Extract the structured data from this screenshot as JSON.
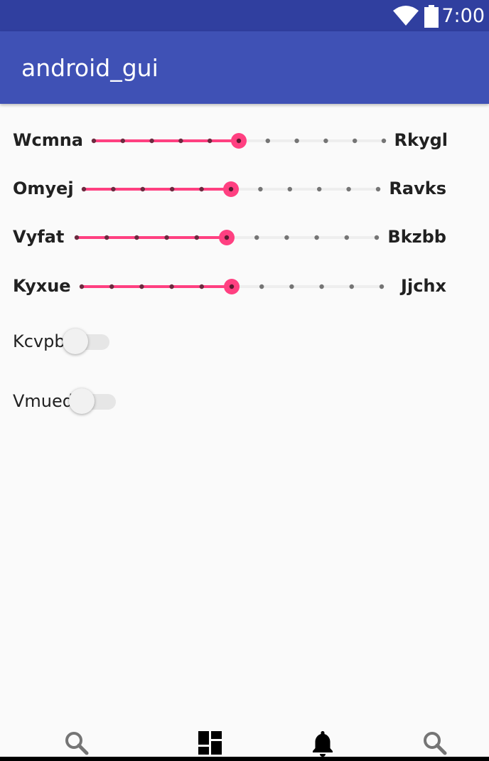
{
  "status_bar": {
    "time": "7:00",
    "icons": [
      "wifi-icon",
      "battery-icon"
    ],
    "color": "#303f9f"
  },
  "app_bar": {
    "title": "android_gui",
    "color": "#3f51b5"
  },
  "sliders": [
    {
      "left_label": "Wcmna",
      "right_label": "Rkygl",
      "value": 5,
      "max": 10
    },
    {
      "left_label": "Omyej",
      "right_label": "Ravks",
      "value": 5,
      "max": 10
    },
    {
      "left_label": "Vyfat",
      "right_label": "Bkzbb",
      "value": 5,
      "max": 10
    },
    {
      "left_label": "Kyxue",
      "right_label": "Jjchx",
      "value": 5,
      "max": 10
    }
  ],
  "switches": [
    {
      "label": "Kcvpb",
      "checked": false
    },
    {
      "label": "Vmued",
      "checked": false
    }
  ],
  "bottom_nav": {
    "items": [
      "search-icon",
      "dashboard-icon",
      "notifications-icon",
      "search-icon"
    ]
  },
  "colors": {
    "accent": "#ff4081",
    "inactive_track": "#eeeeee"
  }
}
